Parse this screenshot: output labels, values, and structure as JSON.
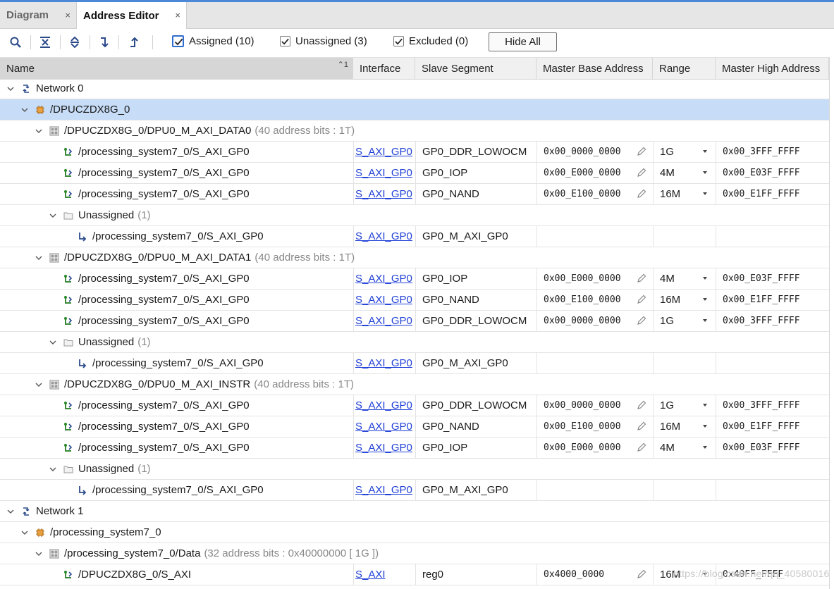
{
  "tabs": [
    {
      "label": "Diagram",
      "close": "×"
    },
    {
      "label": "Address Editor",
      "close": "×"
    }
  ],
  "toolbar": {
    "checkboxes": [
      {
        "label": "Assigned (10)",
        "checked": true
      },
      {
        "label": "Unassigned (3)",
        "checked": true
      },
      {
        "label": "Excluded (0)",
        "checked": true
      }
    ],
    "hide_all": "Hide All"
  },
  "columns": {
    "name": "Name",
    "sort_indicator": "1",
    "interface": "Interface",
    "slave_segment": "Slave Segment",
    "master_base": "Master Base Address",
    "range": "Range",
    "master_high": "Master High Address"
  },
  "rows": [
    {
      "indent": 0,
      "chevron": true,
      "icon": "network-icon",
      "name": "Network 0"
    },
    {
      "indent": 1,
      "chevron": true,
      "icon": "chip-icon",
      "name": "/DPUCZDX8G_0",
      "selected": true
    },
    {
      "indent": 2,
      "chevron": true,
      "icon": "address-space-icon",
      "name": "/DPUCZDX8G_0/DPU0_M_AXI_DATA0",
      "extra": "(40 address bits : 1T)"
    },
    {
      "indent": 3,
      "icon": "slave-segment-icon",
      "name": "/processing_system7_0/S_AXI_GP0",
      "interface": "S_AXI_GP0",
      "segment": "GP0_DDR_LOWOCM",
      "base": "0x00_0000_0000",
      "range": "1G",
      "high": "0x00_3FFF_FFFF"
    },
    {
      "indent": 3,
      "icon": "slave-segment-icon",
      "name": "/processing_system7_0/S_AXI_GP0",
      "interface": "S_AXI_GP0",
      "segment": "GP0_IOP",
      "base": "0x00_E000_0000",
      "range": "4M",
      "high": "0x00_E03F_FFFF"
    },
    {
      "indent": 3,
      "icon": "slave-segment-icon",
      "name": "/processing_system7_0/S_AXI_GP0",
      "interface": "S_AXI_GP0",
      "segment": "GP0_NAND",
      "base": "0x00_E100_0000",
      "range": "16M",
      "high": "0x00_E1FF_FFFF"
    },
    {
      "indent": 3,
      "chevron": true,
      "icon": "folder-icon",
      "name": "Unassigned",
      "extra": "(1)"
    },
    {
      "indent": 4,
      "icon": "unassigned-arrow-icon",
      "name": "/processing_system7_0/S_AXI_GP0",
      "interface": "S_AXI_GP0",
      "segment": "GP0_M_AXI_GP0"
    },
    {
      "indent": 2,
      "chevron": true,
      "icon": "address-space-icon",
      "name": "/DPUCZDX8G_0/DPU0_M_AXI_DATA1",
      "extra": "(40 address bits : 1T)"
    },
    {
      "indent": 3,
      "icon": "slave-segment-icon",
      "name": "/processing_system7_0/S_AXI_GP0",
      "interface": "S_AXI_GP0",
      "segment": "GP0_IOP",
      "base": "0x00_E000_0000",
      "range": "4M",
      "high": "0x00_E03F_FFFF"
    },
    {
      "indent": 3,
      "icon": "slave-segment-icon",
      "name": "/processing_system7_0/S_AXI_GP0",
      "interface": "S_AXI_GP0",
      "segment": "GP0_NAND",
      "base": "0x00_E100_0000",
      "range": "16M",
      "high": "0x00_E1FF_FFFF"
    },
    {
      "indent": 3,
      "icon": "slave-segment-icon",
      "name": "/processing_system7_0/S_AXI_GP0",
      "interface": "S_AXI_GP0",
      "segment": "GP0_DDR_LOWOCM",
      "base": "0x00_0000_0000",
      "range": "1G",
      "high": "0x00_3FFF_FFFF"
    },
    {
      "indent": 3,
      "chevron": true,
      "icon": "folder-icon",
      "name": "Unassigned",
      "extra": "(1)"
    },
    {
      "indent": 4,
      "icon": "unassigned-arrow-icon",
      "name": "/processing_system7_0/S_AXI_GP0",
      "interface": "S_AXI_GP0",
      "segment": "GP0_M_AXI_GP0"
    },
    {
      "indent": 2,
      "chevron": true,
      "icon": "address-space-icon",
      "name": "/DPUCZDX8G_0/DPU0_M_AXI_INSTR",
      "extra": "(40 address bits : 1T)"
    },
    {
      "indent": 3,
      "icon": "slave-segment-icon",
      "name": "/processing_system7_0/S_AXI_GP0",
      "interface": "S_AXI_GP0",
      "segment": "GP0_DDR_LOWOCM",
      "base": "0x00_0000_0000",
      "range": "1G",
      "high": "0x00_3FFF_FFFF"
    },
    {
      "indent": 3,
      "icon": "slave-segment-icon",
      "name": "/processing_system7_0/S_AXI_GP0",
      "interface": "S_AXI_GP0",
      "segment": "GP0_NAND",
      "base": "0x00_E100_0000",
      "range": "16M",
      "high": "0x00_E1FF_FFFF"
    },
    {
      "indent": 3,
      "icon": "slave-segment-icon",
      "name": "/processing_system7_0/S_AXI_GP0",
      "interface": "S_AXI_GP0",
      "segment": "GP0_IOP",
      "base": "0x00_E000_0000",
      "range": "4M",
      "high": "0x00_E03F_FFFF"
    },
    {
      "indent": 3,
      "chevron": true,
      "icon": "folder-icon",
      "name": "Unassigned",
      "extra": "(1)"
    },
    {
      "indent": 4,
      "icon": "unassigned-arrow-icon",
      "name": "/processing_system7_0/S_AXI_GP0",
      "interface": "S_AXI_GP0",
      "segment": "GP0_M_AXI_GP0"
    },
    {
      "indent": 0,
      "chevron": true,
      "icon": "network-icon",
      "name": "Network 1"
    },
    {
      "indent": 1,
      "chevron": true,
      "icon": "chip-icon",
      "name": "/processing_system7_0"
    },
    {
      "indent": 2,
      "chevron": true,
      "icon": "address-space-icon",
      "name": "/processing_system7_0/Data",
      "extra": "(32 address bits : 0x40000000 [ 1G ])"
    },
    {
      "indent": 3,
      "icon": "slave-segment-icon",
      "name": "/DPUCZDX8G_0/S_AXI",
      "interface": "S_AXI",
      "segment": "reg0",
      "base": "0x4000_0000",
      "range": "16M",
      "high": "0x40FF_FFFF"
    }
  ],
  "watermark": "https://blog.csdn.net/qq_40580016"
}
